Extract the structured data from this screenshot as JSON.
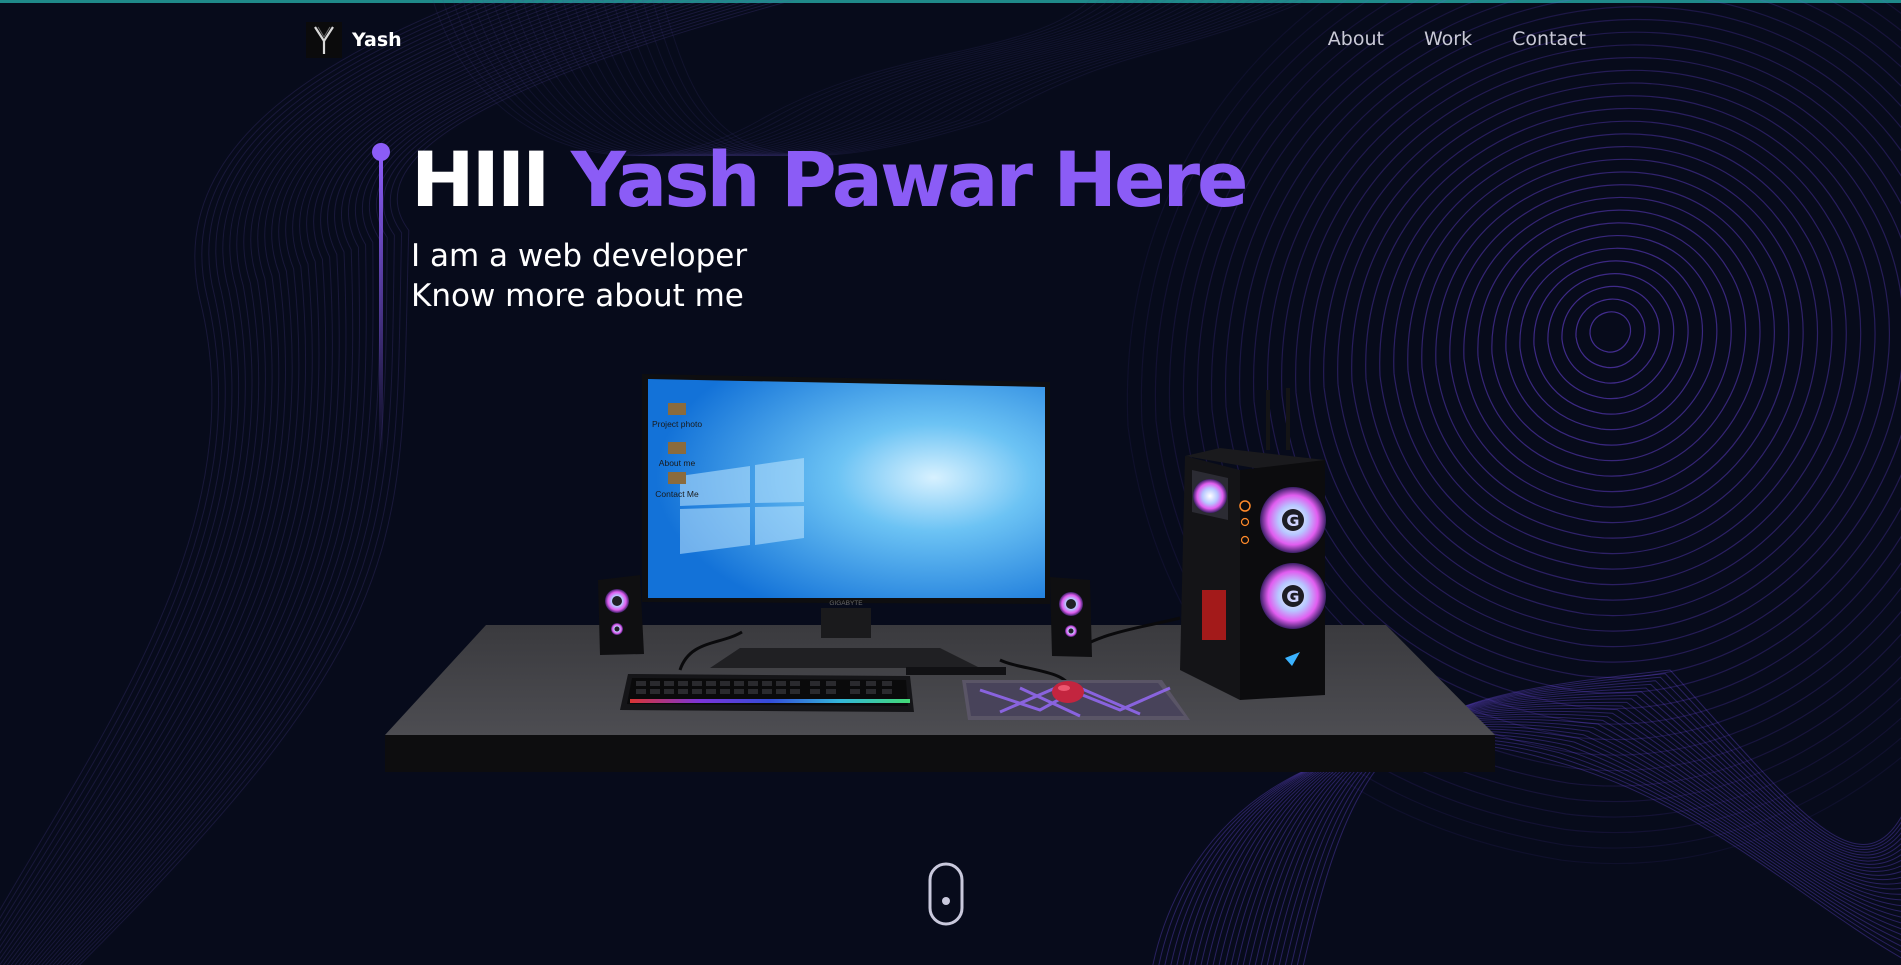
{
  "header": {
    "brand_name": "Yash",
    "logo_letter": "Y",
    "nav": [
      "About",
      "Work",
      "Contact"
    ]
  },
  "hero": {
    "greeting": "HIII",
    "name": "Yash Pawar Here",
    "line1": "I am a web developer",
    "line2": "Know more about me"
  },
  "desktop": {
    "icons": [
      "Project photo",
      "About me",
      "Contact Me"
    ],
    "monitor_brand": "GIGABYTE"
  },
  "colors": {
    "background": "#070b1b",
    "accent": "#8b5cf6",
    "top_line": "#1f8a8a"
  },
  "icons": {
    "scroll": "mouse-scroll-icon"
  }
}
